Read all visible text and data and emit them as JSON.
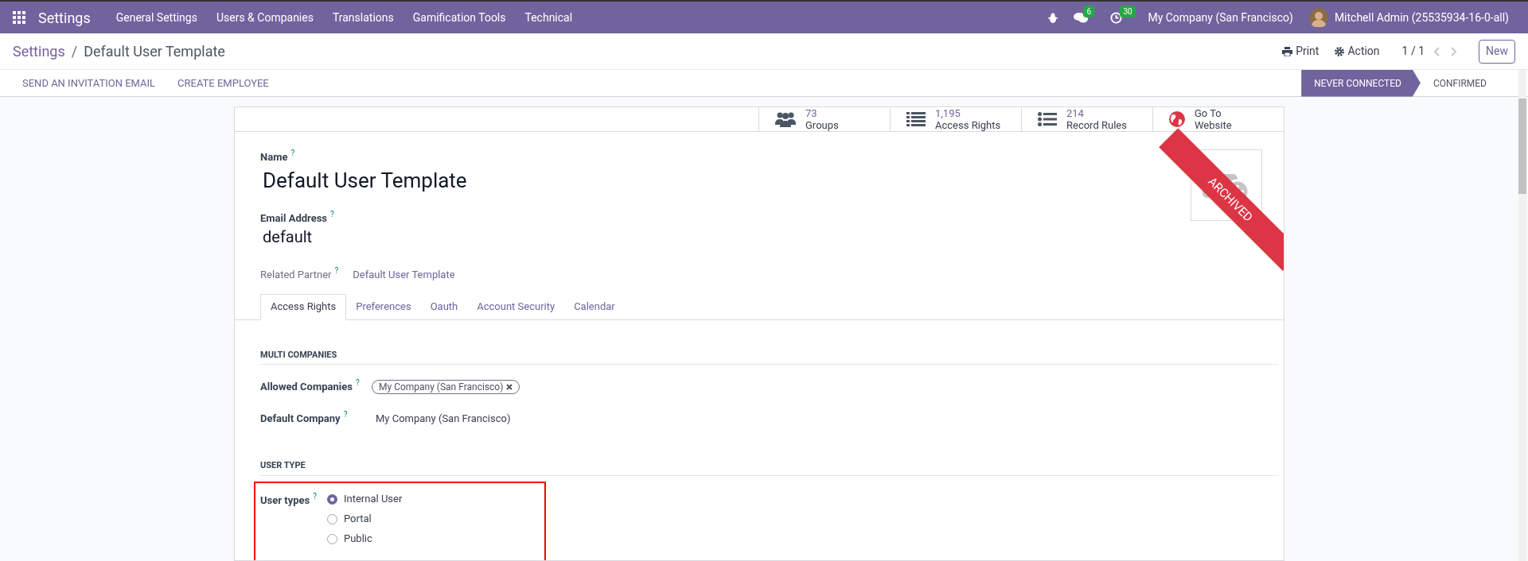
{
  "navbar": {
    "app_name": "Settings",
    "menu": [
      "General Settings",
      "Users & Companies",
      "Translations",
      "Gamification Tools",
      "Technical"
    ],
    "messages_count": "6",
    "activities_count": "30",
    "company": "My Company (San Francisco)",
    "user": "Mitchell Admin (25535934-16-0-all)"
  },
  "breadcrumb": {
    "parent": "Settings",
    "separator": "/",
    "current": "Default User Template"
  },
  "control_panel": {
    "print": "Print",
    "action": "Action",
    "pager": "1 / 1",
    "new_button": "New"
  },
  "header_buttons": [
    "SEND AN INVITATION EMAIL",
    "CREATE EMPLOYEE"
  ],
  "status_stages": [
    {
      "label": "NEVER CONNECTED",
      "selected": true
    },
    {
      "label": "CONFIRMED",
      "selected": false
    }
  ],
  "stat_buttons": [
    {
      "kind": "groups",
      "value": "73",
      "label": "Groups"
    },
    {
      "kind": "list",
      "value": "1,195",
      "label": "Access Rights"
    },
    {
      "kind": "rules",
      "value": "214",
      "label": "Record Rules"
    },
    {
      "kind": "globe",
      "label": "Go To Website"
    }
  ],
  "ribbon": "ARCHIVED",
  "name": {
    "label": "Name",
    "help": "?",
    "value": "Default User Template"
  },
  "email": {
    "label": "Email Address",
    "help": "?",
    "value": "default"
  },
  "related_partner": {
    "label": "Related Partner",
    "help": "?",
    "value": "Default User Template"
  },
  "tabs": [
    {
      "label": "Access Rights",
      "selected": true
    },
    {
      "label": "Preferences",
      "selected": false
    },
    {
      "label": "Oauth",
      "selected": false
    },
    {
      "label": "Account Security",
      "selected": false
    },
    {
      "label": "Calendar",
      "selected": false
    }
  ],
  "multi_companies": {
    "title": "MULTI COMPANIES",
    "allowed_label": "Allowed Companies",
    "allowed_help": "?",
    "allowed_tags": [
      "My Company (San Francisco)"
    ],
    "default_label": "Default Company",
    "default_help": "?",
    "default_value": "My Company (San Francisco)"
  },
  "user_type": {
    "title": "USER TYPE",
    "label": "User types",
    "help": "?",
    "highlighted": true,
    "options": [
      {
        "label": "Internal User",
        "selected": true
      },
      {
        "label": "Portal",
        "selected": false
      },
      {
        "label": "Public",
        "selected": false
      }
    ]
  }
}
